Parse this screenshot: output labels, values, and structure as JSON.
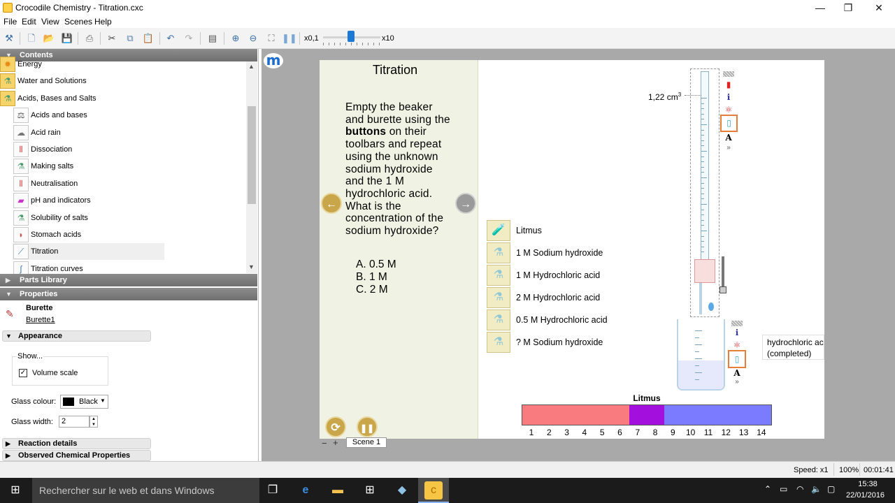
{
  "window": {
    "title": "Crocodile Chemistry - Titration.cxc",
    "minimize": "—",
    "maximize": "❐",
    "close": "✕"
  },
  "menu": [
    "File",
    "Edit",
    "View",
    "Scenes",
    "Help"
  ],
  "toolbar": {
    "zoom_min": "x0,1",
    "zoom_max": "x10"
  },
  "contents_header": "Contents",
  "tree": [
    {
      "label": "Energy",
      "icon": "flame-icon"
    },
    {
      "label": "Water and Solutions",
      "icon": "flask-icon"
    },
    {
      "label": "Acids, Bases and Salts",
      "icon": "flask-icon"
    },
    {
      "label": "Acids and bases",
      "icon": "acid-base-icon"
    },
    {
      "label": "Acid rain",
      "icon": "cloud-icon"
    },
    {
      "label": "Dissociation",
      "icon": "test-tube-icon"
    },
    {
      "label": "Making salts",
      "icon": "flask-icon"
    },
    {
      "label": "Neutralisation",
      "icon": "test-tube-icon"
    },
    {
      "label": "pH and indicators",
      "icon": "ph-strip-icon"
    },
    {
      "label": "Solubility of salts",
      "icon": "flask-icon"
    },
    {
      "label": "Stomach acids",
      "icon": "stomach-icon"
    },
    {
      "label": "Titration",
      "icon": "burette-icon"
    },
    {
      "label": "Titration curves",
      "icon": "curve-icon"
    }
  ],
  "parts_header": "Parts Library",
  "properties_header": "Properties",
  "properties": {
    "name": "Burette",
    "instance": "Burette1",
    "appearance": "Appearance",
    "show": "Show...",
    "volume_scale": "Volume scale",
    "glass_colour_label": "Glass colour:",
    "glass_colour_value": "Black",
    "glass_width_label": "Glass width:",
    "glass_width_value": "2",
    "reaction_details": "Reaction details",
    "observed": "Observed Chemical Properties"
  },
  "scene": {
    "title": "Titration",
    "question_parts": [
      "Empty the beaker and burette using the ",
      "buttons",
      " on their toolbars and repeat using the unknown sodium hydroxide and the 1 M hydrochloric acid. What is the concentration of the sodium hydroxide?"
    ],
    "answers": [
      "A.  0.5 M",
      "B.  1 M",
      "C.  2 M"
    ],
    "tab": "Scene 1",
    "tab_minus": "−",
    "tab_plus": "+"
  },
  "chemicals": [
    "Litmus",
    "1 M Sodium hydroxide",
    "1 M Hydrochloric acid",
    "2 M Hydrochloric acid",
    "0.5 M Hydrochloric acid",
    "? M Sodium hydroxide"
  ],
  "burette": {
    "volume": "1,22 cm",
    "unit_sup": "3"
  },
  "tooltip": {
    "line1": "hydrochloric acid",
    "line2": "(completed)"
  },
  "litmus": {
    "title": "Litmus",
    "numbers": [
      "1",
      "2",
      "3",
      "4",
      "5",
      "6",
      "7",
      "8",
      "9",
      "10",
      "11",
      "12",
      "13",
      "14"
    ],
    "segments": [
      {
        "from": 0,
        "to": 6,
        "color": "#f97b7f"
      },
      {
        "from": 6,
        "to": 8,
        "color": "#a30fdc"
      },
      {
        "from": 8,
        "to": 14,
        "color": "#7b7bff"
      }
    ]
  },
  "status": {
    "speed": "Speed: x1",
    "zoom": "100%",
    "time": "00:01:41"
  },
  "taskbar": {
    "search": "Rechercher sur le web et dans Windows",
    "time": "15:38",
    "date": "22/01/2016"
  }
}
